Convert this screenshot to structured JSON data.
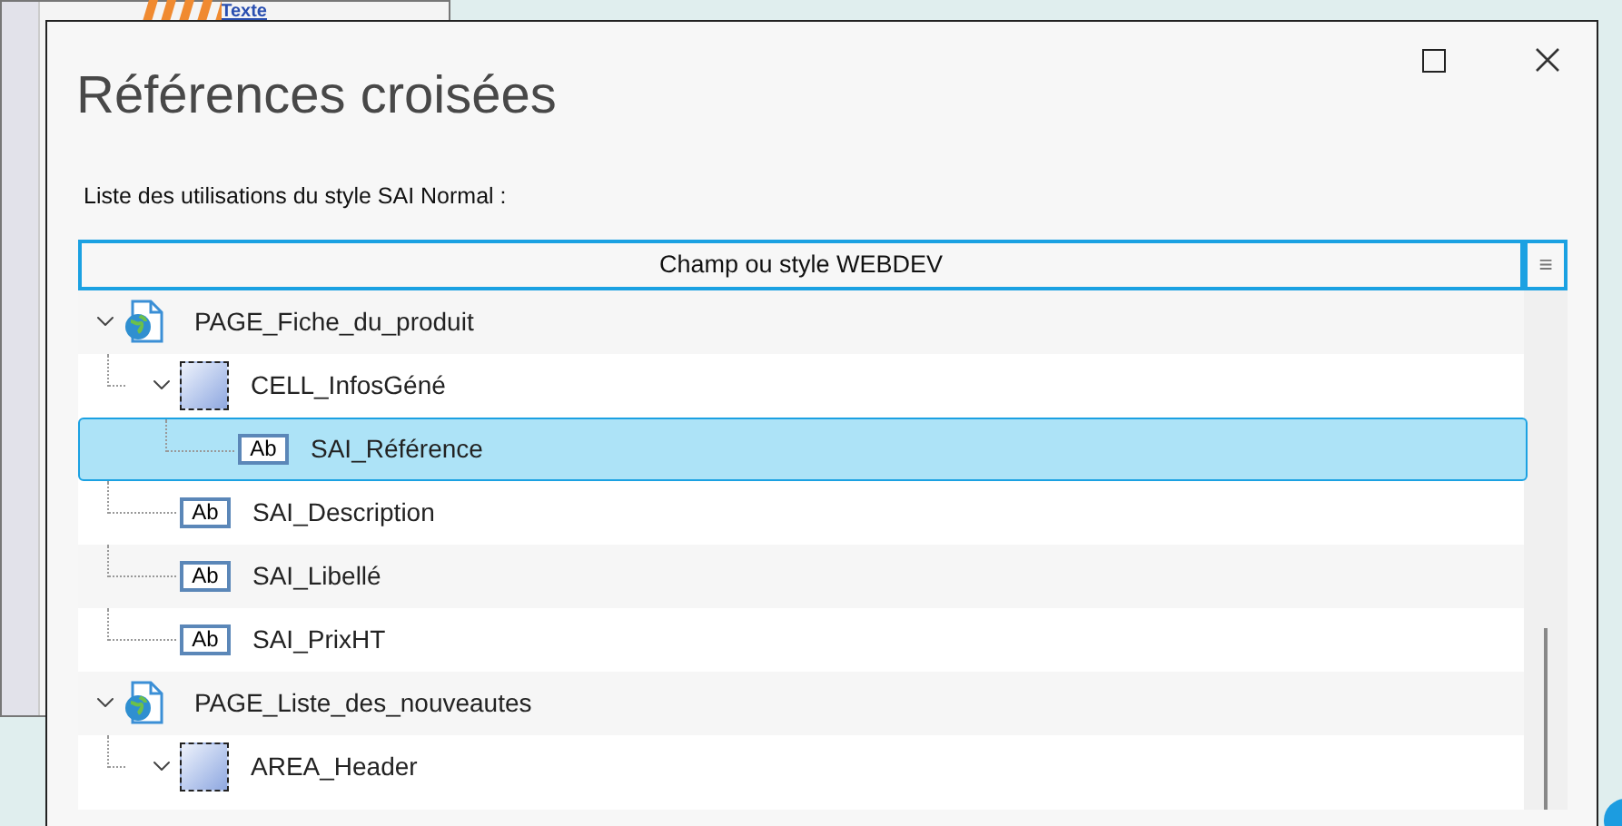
{
  "background_window": {
    "link": "Texte"
  },
  "dialog": {
    "title": "Références croisées",
    "label": "Liste des utilisations du style SAI Normal :"
  },
  "list": {
    "column": "Champ ou style WEBDEV",
    "menu_glyph": "≡",
    "items": [
      {
        "kind": "page",
        "name": "PAGE_Fiche_du_produit",
        "selected": false,
        "expanded": true,
        "children": [
          {
            "kind": "cell",
            "name": "CELL_InfosGéné",
            "selected": false,
            "expanded": true,
            "children": [
              {
                "kind": "field",
                "icon_text": "Ab",
                "name": "SAI_Référence",
                "selected": true
              }
            ]
          },
          {
            "kind": "field",
            "icon_text": "Ab",
            "name": "SAI_Description",
            "selected": false
          },
          {
            "kind": "field",
            "icon_text": "Ab",
            "name": "SAI_Libellé",
            "selected": false
          },
          {
            "kind": "field",
            "icon_text": "Ab",
            "name": "SAI_PrixHT",
            "selected": false
          }
        ]
      },
      {
        "kind": "page",
        "name": "PAGE_Liste_des_nouveautes",
        "selected": false,
        "expanded": true,
        "children": [
          {
            "kind": "cell",
            "name": "AREA_Header",
            "selected": false,
            "expanded": true
          }
        ]
      }
    ]
  }
}
